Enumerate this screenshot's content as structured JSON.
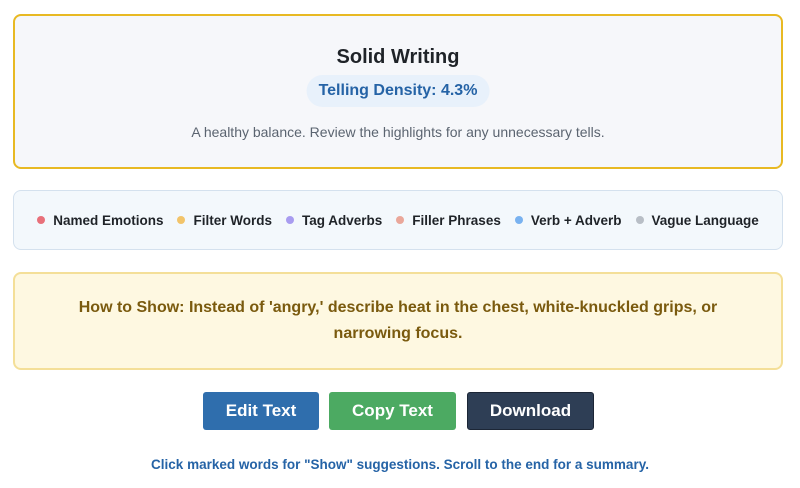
{
  "score": {
    "title": "Solid Writing",
    "density_label": "Telling Density: 4.3%",
    "description": "A healthy balance. Review the highlights for any unnecessary tells."
  },
  "legend": {
    "items": [
      {
        "label": "Named Emotions",
        "color": "#e8707a"
      },
      {
        "label": "Filter Words",
        "color": "#f2c46a"
      },
      {
        "label": "Tag Adverbs",
        "color": "#a89cf0"
      },
      {
        "label": "Filler Phrases",
        "color": "#eaa79a"
      },
      {
        "label": "Verb + Adverb",
        "color": "#79b2f0"
      },
      {
        "label": "Vague Language",
        "color": "#b8bec6"
      }
    ]
  },
  "tip": {
    "text": "How to Show: Instead of 'angry,' describe heat in the chest, white-knuckled grips, or narrowing focus."
  },
  "actions": {
    "edit_label": "Edit Text",
    "copy_label": "Copy Text",
    "download_label": "Download"
  },
  "footer": {
    "hint": "Click marked words for \"Show\" suggestions. Scroll to the end for a summary."
  }
}
